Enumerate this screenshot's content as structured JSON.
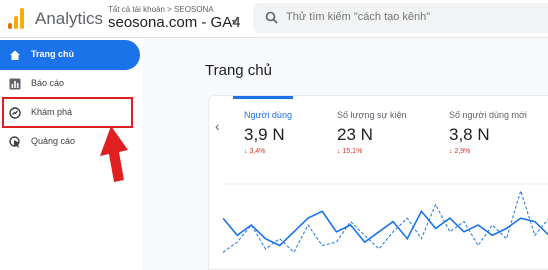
{
  "header": {
    "app_title": "Analytics",
    "account_crumb": "Tất cả tài khoản > SEOSONA",
    "property_name": "seosona.com - GA4",
    "search_placeholder": "Thử tìm kiếm \"cách tạo kênh\"",
    "logo_colors": [
      "#f9ab00",
      "#e37400"
    ]
  },
  "sidebar": {
    "items": [
      {
        "label": "Trang chủ",
        "icon": "home-icon",
        "active": true
      },
      {
        "label": "Báo cáo",
        "icon": "bar-chart-icon",
        "active": false
      },
      {
        "label": "Khám phá",
        "icon": "explore-icon",
        "active": false
      },
      {
        "label": "Quảng cáo",
        "icon": "advertising-icon",
        "active": false
      }
    ],
    "active_color": "#1a73e8",
    "highlight_color": "#e02020"
  },
  "main": {
    "page_title": "Trang chủ",
    "metrics": [
      {
        "label": "Người dùng",
        "value": "3,9 N",
        "change": "↓ 3,4%"
      },
      {
        "label": "Số lượng sự kiện",
        "value": "23 N",
        "change": "↓ 15,1%"
      },
      {
        "label": "Số người dùng mới",
        "value": "3,8 N",
        "change": "↓ 2,9%"
      }
    ],
    "change_color": "#d93025"
  },
  "chart_data": {
    "type": "line",
    "series": [
      {
        "values": [
          14,
          9,
          12,
          8,
          6,
          10,
          14,
          16,
          10,
          12,
          7,
          10,
          13,
          8,
          16,
          11,
          14,
          10,
          12,
          9,
          11,
          14,
          13,
          9
        ]
      },
      {
        "values": [
          4,
          7,
          12,
          5,
          8,
          4,
          12,
          6,
          7,
          13,
          9,
          5,
          10,
          14,
          8,
          18,
          10,
          13,
          6,
          12,
          8,
          22,
          9,
          14
        ]
      }
    ],
    "ylim": [
      0,
      24
    ],
    "grid": false,
    "colors": [
      "#1a73e8",
      "#1a73e8"
    ]
  }
}
